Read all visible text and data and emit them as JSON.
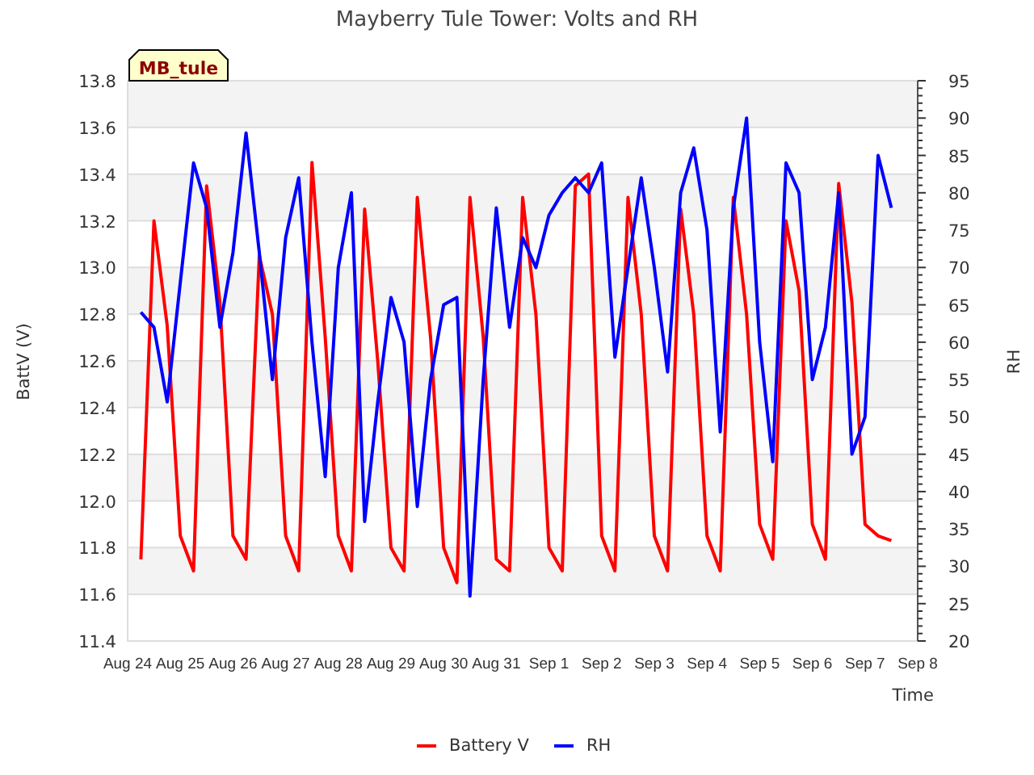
{
  "station_tag": "MB_tule",
  "chart_data": {
    "type": "line",
    "title": "Mayberry Tule Tower: Volts and RH",
    "grid": true,
    "legend": "bottom",
    "xlabel": "Time",
    "ylabel": "BattV (V)",
    "y2label": "RH",
    "categories": [
      "Aug 24",
      null,
      null,
      null,
      "Aug 25",
      null,
      null,
      null,
      "Aug 26",
      null,
      null,
      null,
      "Aug 27",
      null,
      null,
      null,
      "Aug 28",
      null,
      null,
      null,
      "Aug 29",
      null,
      null,
      null,
      "Aug 30",
      null,
      null,
      null,
      "Aug 31",
      null,
      null,
      null,
      "Sep 1",
      null,
      null,
      null,
      "Sep 2",
      null,
      null,
      null,
      "Sep 3",
      null,
      null,
      null,
      "Sep 4",
      null,
      null,
      null,
      "Sep 5",
      null,
      null,
      null,
      "Sep 6",
      null,
      null,
      null,
      "Sep 7",
      null,
      null,
      null,
      "Sep 8"
    ],
    "series": [
      {
        "name": "Battery V",
        "color": "#ff0000",
        "values": [
          null,
          11.75,
          13.2,
          12.75,
          11.85,
          11.7,
          13.35,
          12.85,
          11.85,
          11.75,
          13.05,
          12.8,
          11.85,
          11.7,
          13.45,
          12.7,
          11.85,
          11.7,
          13.25,
          12.6,
          11.8,
          11.7,
          13.3,
          12.7,
          11.8,
          11.65,
          13.3,
          12.7,
          11.75,
          11.7,
          13.3,
          12.8,
          11.8,
          11.7,
          13.35,
          13.4,
          11.85,
          11.7,
          13.3,
          12.8,
          11.85,
          11.7,
          13.25,
          12.8,
          11.85,
          11.7,
          13.3,
          12.8,
          11.9,
          11.75,
          13.2,
          12.9,
          11.9,
          11.75,
          13.36,
          12.85,
          11.9,
          11.85,
          11.83,
          null,
          null
        ]
      },
      {
        "name": "RH",
        "color": "#0000ff",
        "axis": "y2",
        "values": [
          null,
          64,
          62,
          52,
          68,
          84,
          78,
          62,
          72,
          88,
          72,
          55,
          74,
          82,
          60,
          42,
          70,
          80,
          36,
          52,
          66,
          60,
          38,
          55,
          65,
          66,
          26,
          55,
          78,
          62,
          74,
          70,
          77,
          80,
          82,
          80,
          84,
          58,
          70,
          82,
          70,
          56,
          80,
          86,
          75,
          48,
          78,
          90,
          60,
          44,
          84,
          80,
          55,
          62,
          80,
          45,
          50,
          85,
          78,
          null,
          null
        ]
      }
    ],
    "ylim": [
      11.4,
      13.8
    ],
    "y2lim": [
      20,
      95
    ],
    "yticks": [
      11.4,
      11.6,
      11.8,
      {
        "value": 12,
        "label": "12.0"
      },
      12.2,
      12.4,
      12.6,
      12.8,
      {
        "value": 13,
        "label": "13.0"
      },
      13.2,
      13.4,
      13.6,
      13.8
    ],
    "y2ticks": [
      20,
      25,
      30,
      35,
      40,
      45,
      50,
      55,
      60,
      65,
      70,
      75,
      80,
      85,
      90,
      95
    ]
  }
}
